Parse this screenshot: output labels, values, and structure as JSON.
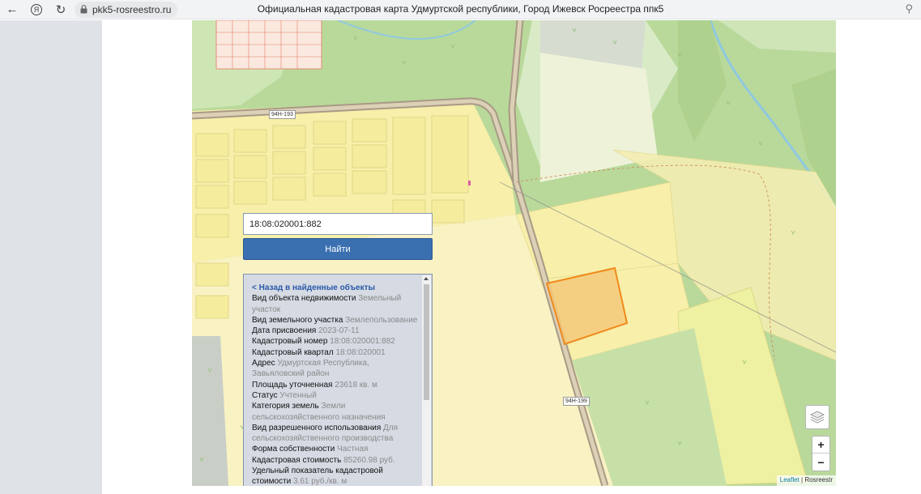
{
  "browser": {
    "url": "pkk5-rosreestro.ru",
    "title": "Официальная кадастровая карта Удмуртской республики, Город Ижевск Росреестра ппк5",
    "yandex_label": "Я"
  },
  "map": {
    "road_labels": [
      "94Н-193",
      "94Н-199"
    ],
    "attribution_leaflet": "Leaflet",
    "attribution_sep": " | ",
    "attribution_source": "Rosreestr",
    "zoom_in": "+",
    "zoom_out": "−"
  },
  "search": {
    "value": "18:08:020001:882",
    "button_label": "Найти"
  },
  "info": {
    "back_link": "< Назад в найденные объекты",
    "rows": [
      {
        "label": "Вид объекта недвижимости",
        "value": "Земельный участок"
      },
      {
        "label": "Вид земельного участка",
        "value": "Землепользование"
      },
      {
        "label": "Дата присвоения",
        "value": "2023-07-11"
      },
      {
        "label": "Кадастровый номер",
        "value": "18:08:020001:882"
      },
      {
        "label": "Кадастровый квартал",
        "value": "18:08:020001"
      },
      {
        "label": "Адрес",
        "value": "Удмуртская Республика, Завьяловский район"
      },
      {
        "label": "Площадь уточненная",
        "value": "23618 кв. м"
      },
      {
        "label": "Статус",
        "value": "Учтенный"
      },
      {
        "label": "Категория земель",
        "value": "Земли сельскохозяйственного назначения"
      },
      {
        "label": "Вид разрешенного использования",
        "value": "Для сельскохозяйственного производства"
      },
      {
        "label": "Форма собственности",
        "value": "Частная"
      },
      {
        "label": "Кадастровая стоимость",
        "value": "85260.98 руб."
      },
      {
        "label": "Удельный показатель кадастровой стоимости",
        "value": "3.61 руб./кв. м"
      }
    ]
  },
  "colors": {
    "forest": "#b9d99b",
    "parcel_yellow": "#f7efaa",
    "selected_parcel": "#f5c97a",
    "selected_border": "#f08a1c",
    "button_blue": "#3a6fb0"
  }
}
